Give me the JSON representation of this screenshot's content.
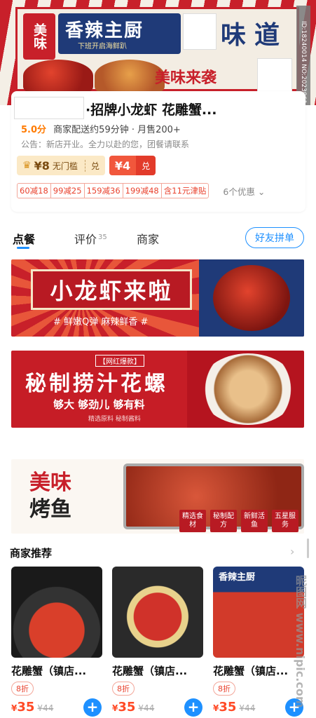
{
  "header": {
    "brand_badge": "美味",
    "brand_name": "香辣主厨",
    "brand_tagline": "下班开启海鲜趴",
    "brand_taste": "味道",
    "slogan": "美味来袭",
    "id_watermark": "ID:18240014 NO:20230614110679150"
  },
  "shop": {
    "title": "·招牌小龙虾 花雕蟹...",
    "rating": "5.0分",
    "delivery_info": "商家配送约59分钟 · 月售200+",
    "notice": "公告：新店开业。全力以赴的您，团餐请联系",
    "coupon_gold": {
      "amount": "¥8",
      "condition": "无门槛",
      "action": "兑"
    },
    "coupon_red": {
      "amount": "¥4",
      "action": "兑"
    },
    "promos": [
      "60减18",
      "99减25",
      "159减36",
      "199减48",
      "含11元津贴"
    ],
    "promo_more": "6个优惠 ⌄"
  },
  "tabs": {
    "order": "点餐",
    "review": "评价",
    "review_count": "35",
    "merchant": "商家",
    "friend_group": "好友拼单"
  },
  "banners": {
    "crayfish_title": "小龙虾来啦",
    "crayfish_sub": "# 鲜嫩Q弹  麻辣鲜香 #",
    "snail_tag": "【网红爆款】",
    "snail_title": "秘制捞汁花螺",
    "snail_sub": "够大  够劲儿  够有料",
    "snail_sub2": "精选原料  秘制酱料",
    "fish_title_1": "美味",
    "fish_title_2": "烤鱼",
    "fish_chips": [
      "精选食材",
      "秘制配方",
      "新鲜活鱼",
      "五星服务"
    ]
  },
  "recommend": {
    "title": "商家推荐",
    "arrow": "›",
    "items": [
      {
        "name": "花雕蟹（镇店...",
        "discount": "8折",
        "currency": "¥",
        "price": "35",
        "original": "¥44"
      },
      {
        "name": "花雕蟹（镇店...",
        "discount": "8折",
        "currency": "¥",
        "price": "35",
        "original": "¥44"
      },
      {
        "name": "花雕蟹（镇店...",
        "discount": "8折",
        "currency": "¥",
        "price": "35",
        "original": "¥44",
        "image_brand": "香辣主厨"
      }
    ]
  },
  "watermark_bottom": "昵图网 www.nipic.com",
  "colors": {
    "accent_blue": "#1e90ff",
    "brand_red": "#c8202a",
    "price_orange": "#ff4a26",
    "rating_orange": "#ff7a00"
  }
}
